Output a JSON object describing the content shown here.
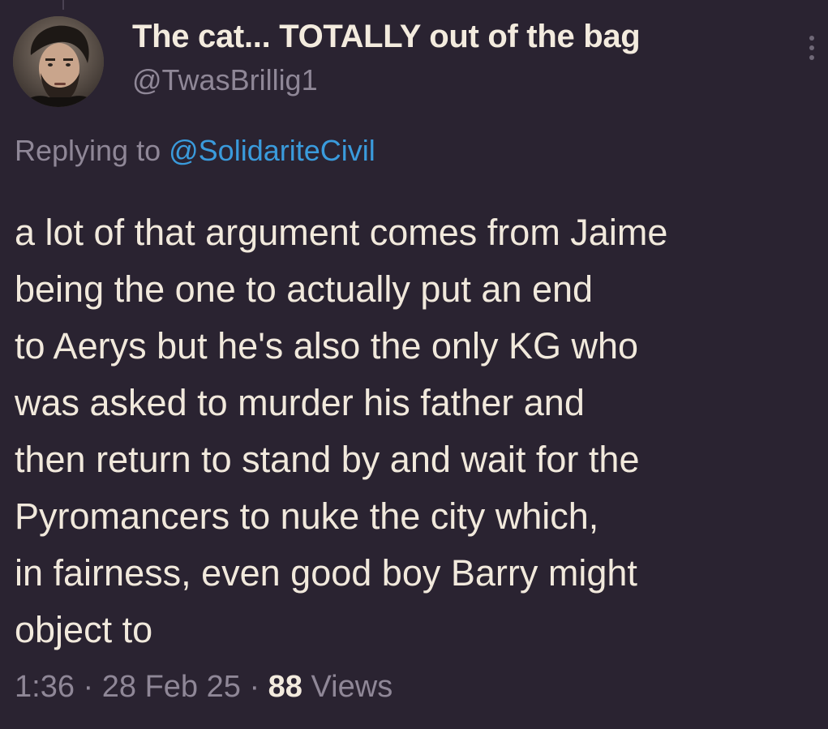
{
  "author": {
    "display_name": "The cat... TOTALLY out of the bag",
    "handle": "@TwasBrillig1",
    "avatar_icon": "profile-photo"
  },
  "reply": {
    "prefix": "Replying to",
    "mention": "@SolidariteCivil"
  },
  "body_lines": [
    "a lot of that argument comes from Jaime",
    "being the one to actually put an end",
    "to Aerys but he's also the only KG who",
    "was asked to murder his father and",
    "then return to stand by and wait for the",
    "Pyromancers to nuke the city which,",
    "in fairness, even good boy Barry might",
    "object to"
  ],
  "meta": {
    "time": "1:36",
    "sep1": " · ",
    "date": "28 Feb 25",
    "sep2": " · ",
    "views_count": "88",
    "views_label": " Views"
  },
  "colors": {
    "background": "#2a2331",
    "text": "#f1e9dc",
    "muted": "#8f8797",
    "link": "#3a9bdc"
  },
  "icons": {
    "more": "more-vertical-icon"
  }
}
